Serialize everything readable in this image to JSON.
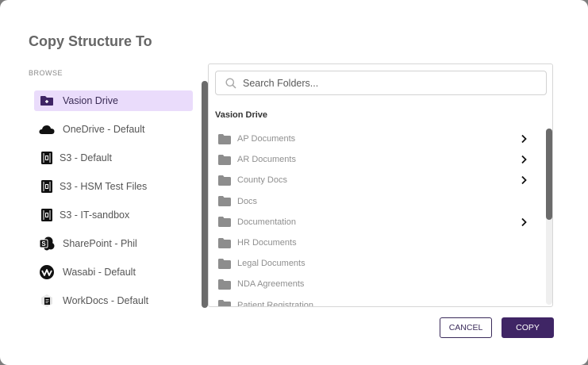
{
  "dialog": {
    "title": "Copy Structure To",
    "browse_label": "BROWSE"
  },
  "sources": [
    {
      "label": "Vasion Drive",
      "icon": "vasion-drive-icon",
      "active": true
    },
    {
      "label": "OneDrive - Default",
      "icon": "onedrive-icon",
      "active": false
    },
    {
      "label": "S3 - Default",
      "icon": "s3-icon",
      "active": false
    },
    {
      "label": "S3 - HSM Test Files",
      "icon": "s3-icon",
      "active": false
    },
    {
      "label": "S3 - IT-sandbox",
      "icon": "s3-icon",
      "active": false
    },
    {
      "label": "SharePoint - Phil",
      "icon": "sharepoint-icon",
      "active": false
    },
    {
      "label": "Wasabi - Default",
      "icon": "wasabi-icon",
      "active": false
    },
    {
      "label": "WorkDocs - Default",
      "icon": "workdocs-icon",
      "active": false
    }
  ],
  "search": {
    "placeholder": "Search Folders..."
  },
  "browser": {
    "section_title": "Vasion Drive",
    "folders": [
      {
        "name": "AP Documents",
        "has_children": true
      },
      {
        "name": "AR Documents",
        "has_children": true
      },
      {
        "name": "County Docs",
        "has_children": true
      },
      {
        "name": "Docs",
        "has_children": false
      },
      {
        "name": "Documentation",
        "has_children": true
      },
      {
        "name": "HR Documents",
        "has_children": false
      },
      {
        "name": "Legal Documents",
        "has_children": false
      },
      {
        "name": "NDA Agreements",
        "has_children": false
      },
      {
        "name": "Patient Registration",
        "has_children": false
      }
    ]
  },
  "buttons": {
    "cancel_label": "CANCEL",
    "copy_label": "COPY"
  },
  "colors": {
    "accent": "#3f2565",
    "active_bg": "#eadcfb"
  }
}
